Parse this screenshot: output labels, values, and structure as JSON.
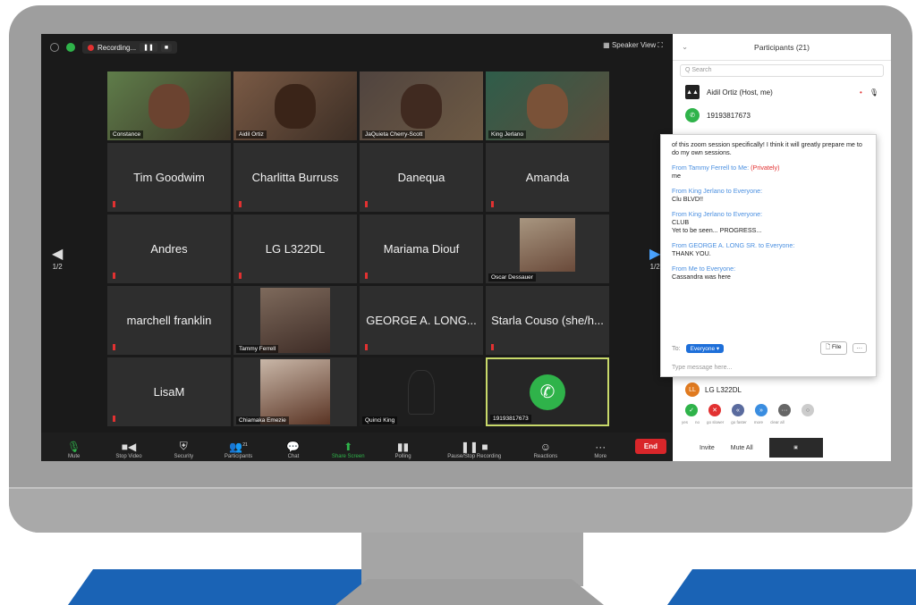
{
  "topbar": {
    "recording_label": "Recording...",
    "speaker_view": "Speaker View"
  },
  "tiles": [
    {
      "name": "Constance",
      "type": "video"
    },
    {
      "name": "Aidil Ortiz",
      "type": "video"
    },
    {
      "name": "JaQuieta Cherry-Scott",
      "type": "video"
    },
    {
      "name": "King Jerlano",
      "type": "video"
    },
    {
      "name": "Tim Goodwim",
      "type": "name"
    },
    {
      "name": "Charlitta Burruss",
      "type": "name"
    },
    {
      "name": "Danequa",
      "type": "name"
    },
    {
      "name": "Amanda",
      "type": "name"
    },
    {
      "name": "Andres",
      "type": "name"
    },
    {
      "name": "LG L322DL",
      "type": "name"
    },
    {
      "name": "Mariama Diouf",
      "type": "name"
    },
    {
      "name": "Oscar Dessauer",
      "type": "video"
    },
    {
      "name": "marchell franklin",
      "type": "name"
    },
    {
      "name": "Tammy Ferrell",
      "type": "video"
    },
    {
      "name": "GEORGE A. LONG...",
      "type": "name"
    },
    {
      "name": "Starla Couso (she/h...",
      "type": "name"
    },
    {
      "name": "LisaM",
      "type": "name"
    },
    {
      "name": "Chiamaka Emezie",
      "type": "video"
    },
    {
      "name": "Quinci King",
      "type": "video"
    },
    {
      "name": "19193817673",
      "type": "phone"
    }
  ],
  "nav": {
    "left_page": "1/2",
    "right_page": "1/2"
  },
  "toolbar": {
    "mute": "Mute",
    "stop_video": "Stop Video",
    "security": "Security",
    "participants": "Participants",
    "participants_count": "21",
    "chat": "Chat",
    "share_screen": "Share Screen",
    "polling": "Polling",
    "pause_recording": "Pause/Stop Recording",
    "reactions": "Reactions",
    "more": "More",
    "end": "End"
  },
  "participants": {
    "title": "Participants (21)",
    "search_placeholder": "Q Search",
    "host": "Aidil Ortiz (Host, me)",
    "phone": "19193817673",
    "lg": "LG L322DL",
    "lg_initials": "LL",
    "invite": "Invite",
    "mute_all": "Mute All"
  },
  "chat": {
    "intro": "of this zoom session specifically! I think it will greatly prepare me to do my own sessions.",
    "messages": [
      {
        "from": "From Tammy Ferrell to Me:",
        "private": "(Privately)",
        "text": "me"
      },
      {
        "from": "From King Jerlano to Everyone:",
        "private": "",
        "text": "Clu BLVD!!"
      },
      {
        "from": "From King Jerlano to Everyone:",
        "private": "",
        "text": "CLUB"
      },
      {
        "from": "",
        "private": "",
        "text": "Yet to be seen... PROGRESS..."
      },
      {
        "from": "From GEORGE A. LONG SR. to Everyone:",
        "private": "",
        "text": "THANK YOU."
      },
      {
        "from": "From Me to Everyone:",
        "private": "",
        "text": "Cassandra was here"
      }
    ],
    "to_label": "To:",
    "to_value": "Everyone",
    "file": "File",
    "placeholder": "Type message here..."
  },
  "reaction_labels": [
    "yes",
    "no",
    "go slower",
    "go faster",
    "more",
    "clear all"
  ],
  "colors": {
    "share": "#2fb34a",
    "end": "#d9262a",
    "link": "#4a8fe0",
    "private": "#e23131"
  }
}
